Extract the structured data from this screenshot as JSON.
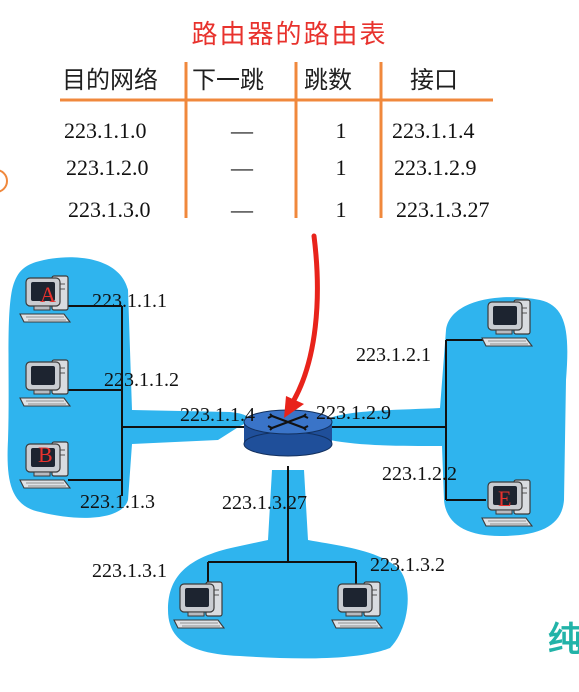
{
  "title": "路由器的路由表",
  "routing_table": {
    "headers": [
      "目的网络",
      "下一跳",
      "跳数",
      "接口"
    ],
    "rows": [
      [
        "223.1.1.0",
        "—",
        "1",
        "223.1.1.4"
      ],
      [
        "223.1.2.0",
        "—",
        "1",
        "223.1.2.9"
      ],
      [
        "223.1.3.0",
        "—",
        "1",
        "223.1.3.27"
      ]
    ]
  },
  "hosts": {
    "A": "A",
    "B": "B",
    "E": "E"
  },
  "addresses": {
    "a": "223.1.1.1",
    "h2": "223.1.1.2",
    "b": "223.1.1.3",
    "r1": "223.1.1.4",
    "r2": "223.1.2.9",
    "r3": "223.1.3.27",
    "n21": "223.1.2.1",
    "n22": "223.1.2.2",
    "n31": "223.1.3.1",
    "n32": "223.1.3.2"
  },
  "corner_char": "纯",
  "colors": {
    "title": "#e8322d",
    "table_rule": "#f0883c",
    "network_blob": "#2fb4ee",
    "router": "#2f63b8",
    "arrow": "#e8231b",
    "host_letter": "#e8322d",
    "corner_char": "#22b3a8"
  }
}
